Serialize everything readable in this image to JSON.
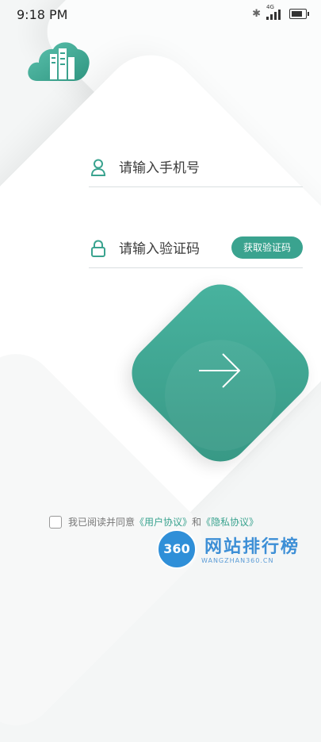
{
  "status_bar": {
    "time": "9:18 PM",
    "network_label": "4G"
  },
  "form": {
    "phone_placeholder": "请输入手机号",
    "code_placeholder": "请输入验证码",
    "get_code_label": "获取验证码"
  },
  "agreement": {
    "text": "我已阅读并同意",
    "user_agreement": "《用户协议》",
    "connector": "和",
    "privacy_policy": "《隐私协议》"
  },
  "watermark": {
    "badge": "360",
    "title": "网站排行榜",
    "subtitle": "WANGZHAN360.CN"
  },
  "colors": {
    "accent": "#3aa38f",
    "watermark_blue": "#3d8fd6"
  },
  "icons": [
    "cloud-building-logo-icon",
    "user-icon",
    "lock-icon",
    "arrow-right-icon",
    "bluetooth-icon",
    "signal-icon",
    "battery-icon"
  ]
}
